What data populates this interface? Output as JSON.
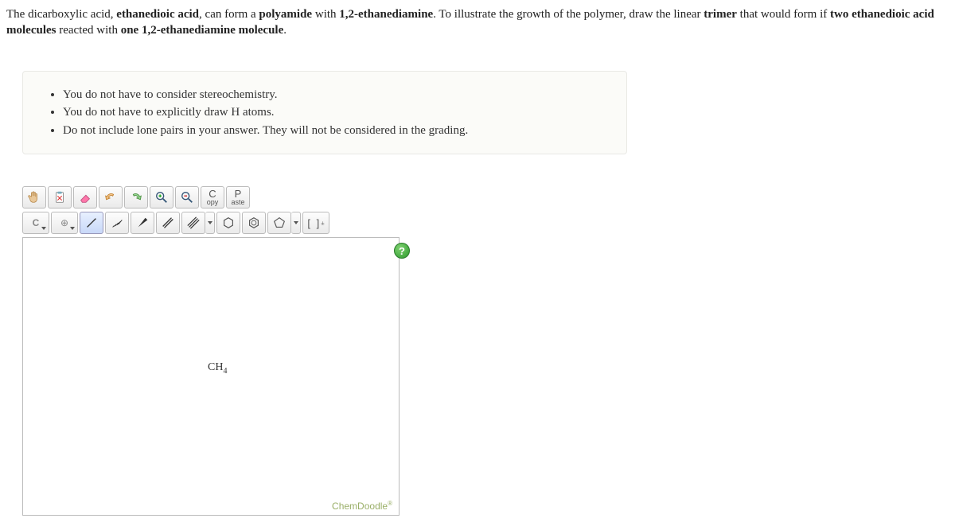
{
  "question": {
    "p1a": "The dicarboxylic acid, ",
    "b1": "ethanedioic acid",
    "p1b": ", can form a ",
    "b2": "polyamide",
    "p1c": " with ",
    "b3": "1,2-ethanediamine",
    "p1d": ". To illustrate the growth of the polymer, draw the linear ",
    "b4": "trimer",
    "p1e": " that would form if ",
    "b5": "two ethanedioic acid molecules",
    "p1f": " reacted with ",
    "b6": "one 1,2-ethanediamine molecule",
    "p1g": "."
  },
  "instructions": [
    "You do not have to consider stereochemistry.",
    "You do not have to explicitly draw H atoms.",
    "Do not include lone pairs in your answer. They will not be considered in the grading."
  ],
  "toolbar1": {
    "copy_big": "C",
    "copy_small": "opy",
    "paste_big": "P",
    "paste_small": "aste"
  },
  "toolbar2": {
    "element": "C",
    "charge": "⊕",
    "bracket": "[ ]",
    "bracket_sup": "±"
  },
  "canvas": {
    "molecule": "CH",
    "molecule_sub": "4",
    "brand": "ChemDoodle",
    "brand_sup": "®",
    "help": "?"
  }
}
